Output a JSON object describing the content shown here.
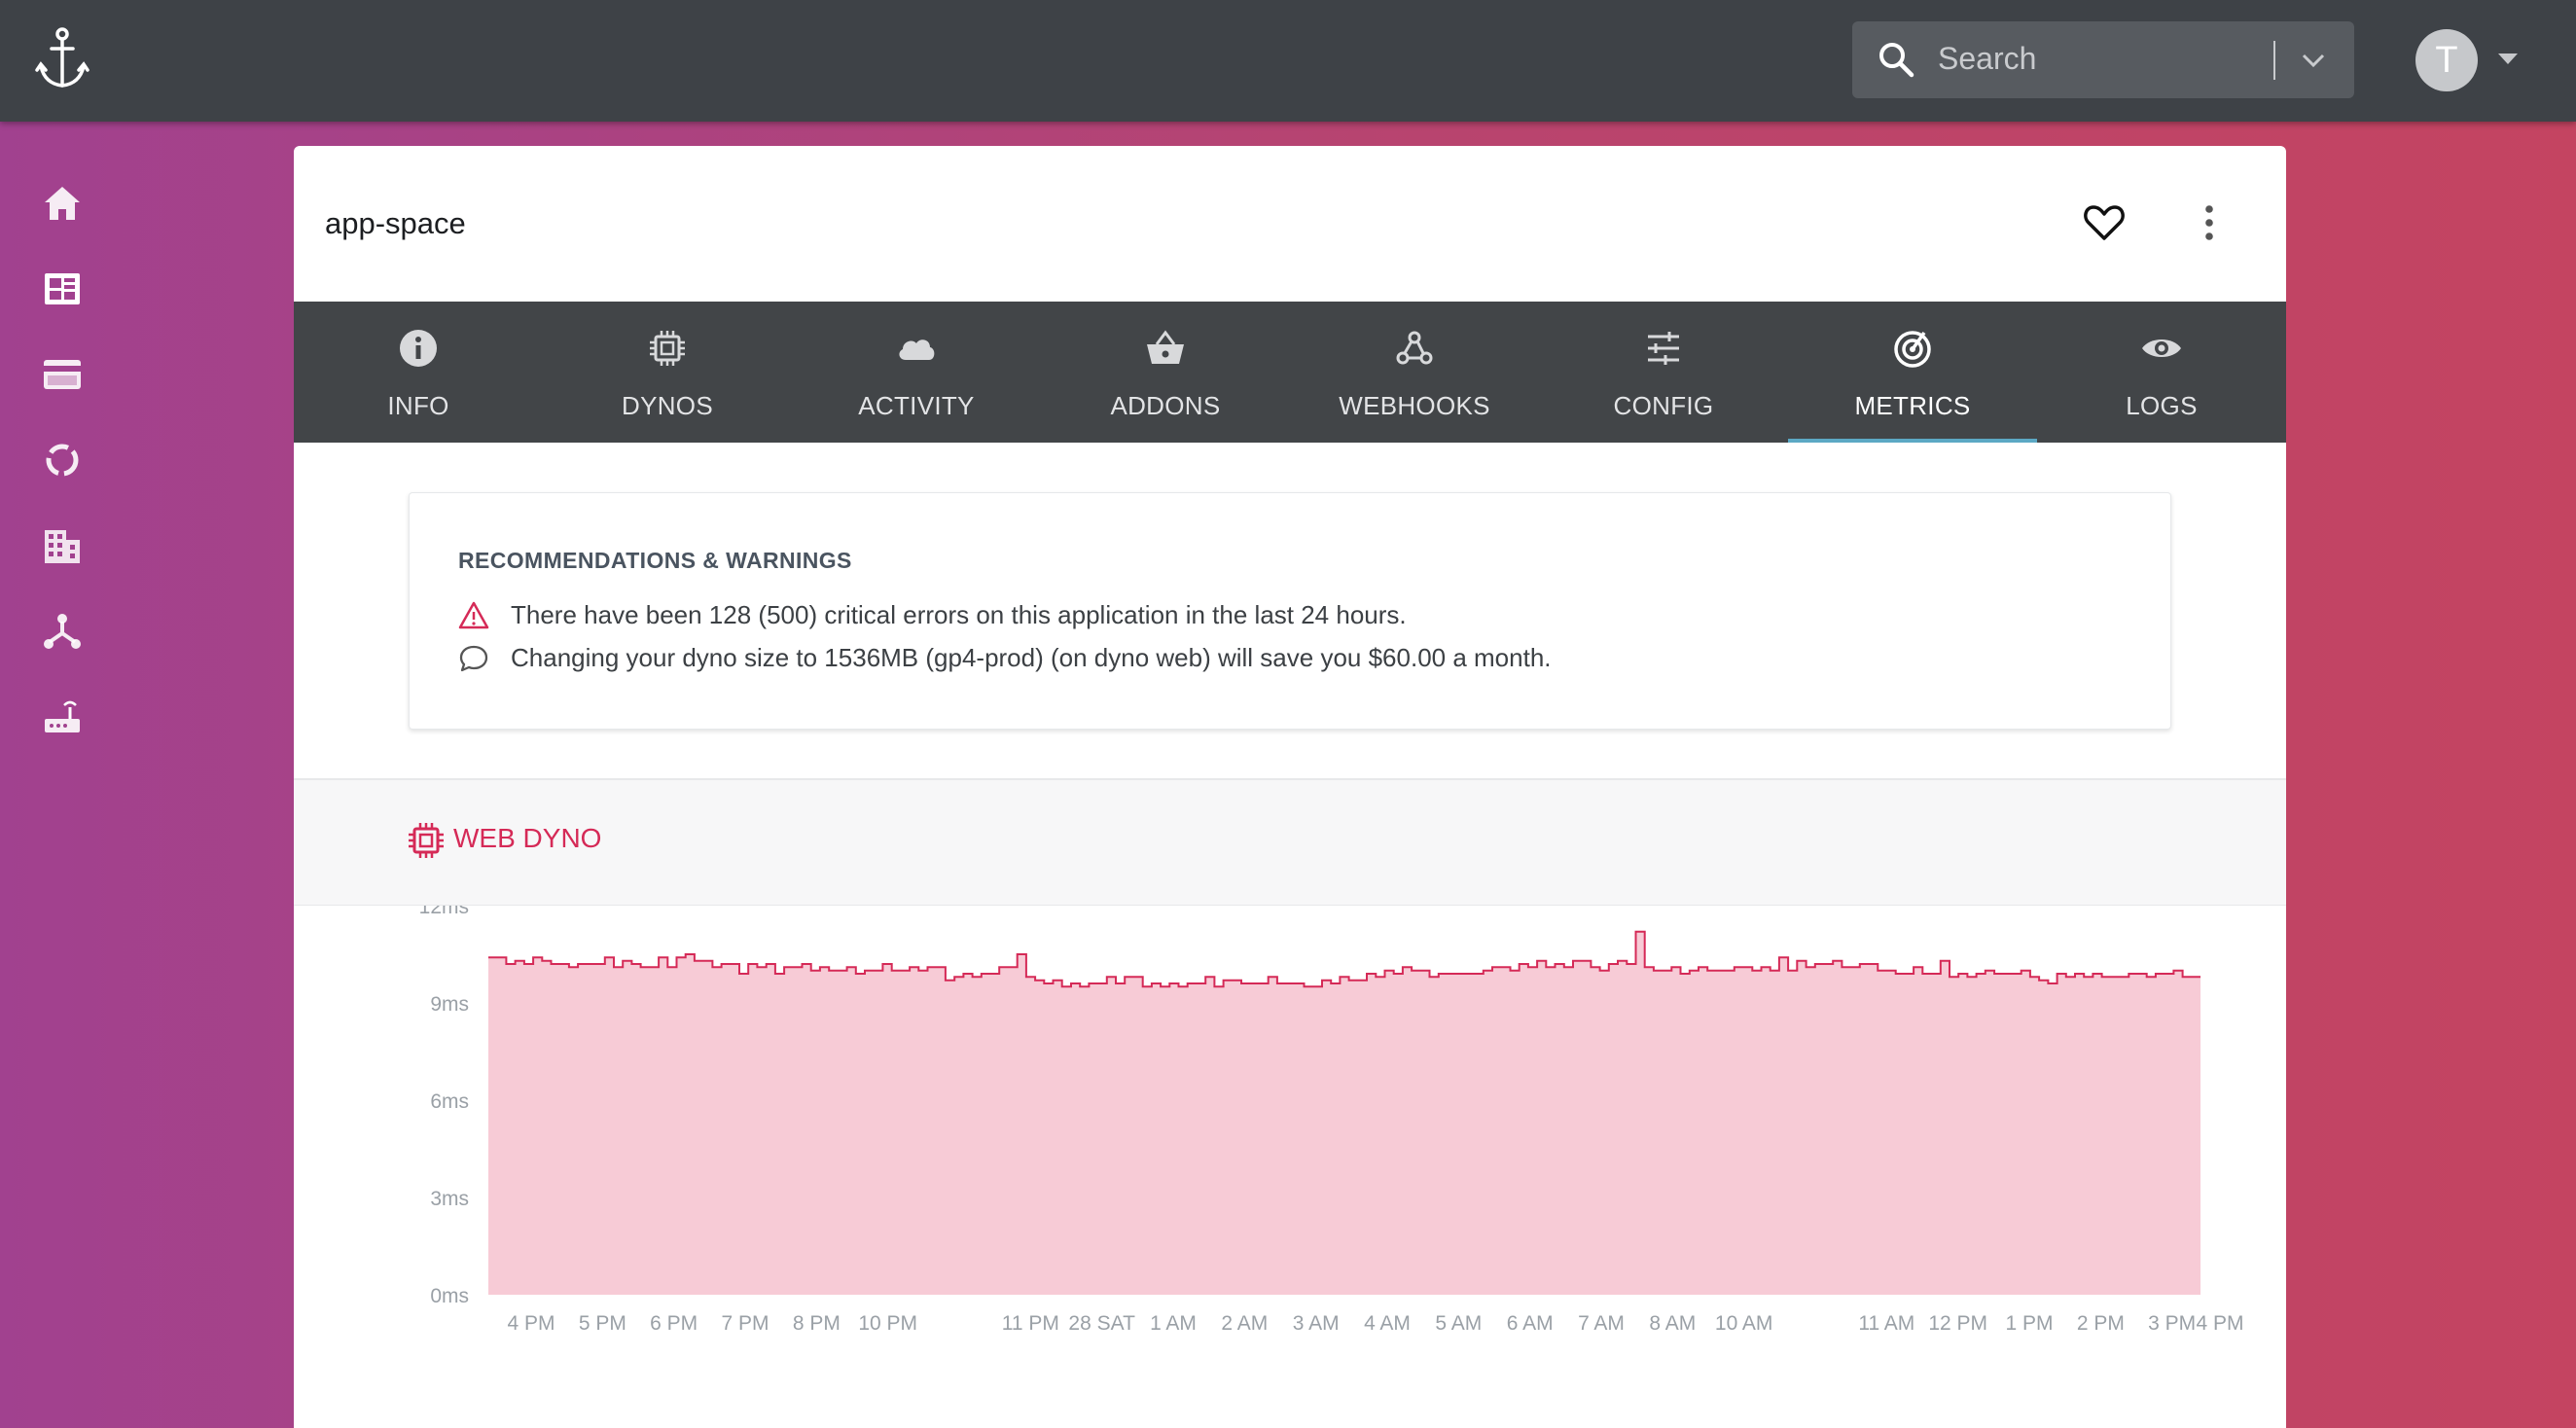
{
  "topbar": {
    "logo_icon": "anchor-icon",
    "search_placeholder": "Search",
    "avatar_initial": "T"
  },
  "sidebar": {
    "items": [
      {
        "icon": "home-icon"
      },
      {
        "icon": "dashboard-icon"
      },
      {
        "icon": "credit-card-icon"
      },
      {
        "icon": "pipeline-icon"
      },
      {
        "icon": "building-icon"
      },
      {
        "icon": "network-icon"
      },
      {
        "icon": "router-icon"
      }
    ]
  },
  "app": {
    "name": "app-space"
  },
  "tabs": [
    {
      "label": "INFO",
      "icon": "info-icon"
    },
    {
      "label": "DYNOS",
      "icon": "chip-icon"
    },
    {
      "label": "ACTIVITY",
      "icon": "cloud-icon"
    },
    {
      "label": "ADDONS",
      "icon": "basket-icon"
    },
    {
      "label": "WEBHOOKS",
      "icon": "webhook-icon"
    },
    {
      "label": "CONFIG",
      "icon": "sliders-icon"
    },
    {
      "label": "METRICS",
      "icon": "target-icon",
      "active": true
    },
    {
      "label": "LOGS",
      "icon": "eye-icon"
    }
  ],
  "recommendations": {
    "title": "RECOMMENDATIONS & WARNINGS",
    "items": [
      {
        "icon": "warning-icon",
        "text": "There have been 128 (500) critical errors on this application in the last 24 hours."
      },
      {
        "icon": "comment-icon",
        "text": "Changing your dyno size to 1536MB (gp4-prod) (on dyno web) will save you $60.00 a month."
      }
    ]
  },
  "dyno_section": {
    "label": "WEB DYNO",
    "icon": "chip-icon"
  },
  "colors": {
    "accent": "#d52a57",
    "area_fill": "#f7cbd6",
    "tab_underline": "#5ca8c4"
  },
  "chart_data": {
    "type": "area",
    "ylim": [
      0,
      12
    ],
    "yticks": [
      "0ms",
      "3ms",
      "6ms",
      "9ms",
      "12ms"
    ],
    "x_tick_labels": [
      "4 PM",
      "5 PM",
      "6 PM",
      "7 PM",
      "8 PM",
      "10 PM",
      "11 PM",
      "28 SAT",
      "1 AM",
      "2 AM",
      "3 AM",
      "4 AM",
      "5 AM",
      "6 AM",
      "7 AM",
      "8 AM",
      "10 AM",
      "11 AM",
      "12 PM",
      "1 PM",
      "2 PM",
      "3 PM",
      "4 PM"
    ],
    "x_positions_hours": [
      0,
      1,
      2,
      3,
      4,
      5,
      6,
      7,
      8,
      9,
      10,
      11,
      12,
      13,
      14,
      15,
      16,
      17,
      18,
      19,
      20,
      21,
      22,
      23,
      24
    ],
    "series": [
      {
        "values": [
          10.4,
          10.4,
          10.2,
          10.3,
          10.2,
          10.4,
          10.3,
          10.2,
          10.2,
          10.1,
          10.2,
          10.2,
          10.2,
          10.4,
          10.1,
          10.3,
          10.2,
          10.1,
          10.1,
          10.4,
          10.1,
          10.4,
          10.5,
          10.3,
          10.3,
          10.1,
          10.2,
          10.2,
          9.9,
          10.2,
          10.1,
          10.2,
          9.9,
          10.1,
          10.1,
          10.2,
          10.0,
          10.1,
          10.0,
          10.0,
          10.1,
          9.9,
          10.0,
          10.0,
          10.2,
          10.0,
          10.0,
          10.1,
          10.0,
          10.1,
          10.1,
          9.7,
          9.8,
          9.9,
          9.8,
          9.9,
          9.9,
          10.1,
          10.1,
          10.5,
          9.8,
          9.7,
          9.6,
          9.7,
          9.5,
          9.6,
          9.5,
          9.6,
          9.6,
          9.8,
          9.6,
          9.8,
          9.8,
          9.5,
          9.6,
          9.5,
          9.6,
          9.5,
          9.6,
          9.6,
          9.8,
          9.5,
          9.7,
          9.7,
          9.6,
          9.6,
          9.6,
          9.8,
          9.6,
          9.6,
          9.6,
          9.5,
          9.5,
          9.7,
          9.6,
          9.8,
          9.7,
          9.7,
          9.9,
          9.8,
          10.0,
          9.9,
          10.1,
          10.0,
          10.0,
          9.8,
          9.9,
          9.9,
          9.9,
          9.9,
          9.9,
          10.0,
          10.1,
          10.1,
          10.0,
          10.2,
          10.1,
          10.3,
          10.1,
          10.2,
          10.1,
          10.3,
          10.3,
          10.1,
          10.0,
          10.2,
          10.3,
          10.2,
          11.2,
          10.1,
          10.0,
          10.0,
          10.1,
          9.9,
          10.0,
          10.1,
          10.0,
          10.0,
          10.0,
          10.1,
          10.1,
          10.0,
          10.1,
          10.0,
          10.4,
          10.0,
          10.3,
          10.1,
          10.2,
          10.2,
          10.3,
          10.1,
          10.1,
          10.2,
          10.2,
          10.0,
          10.0,
          9.9,
          9.9,
          10.1,
          9.9,
          9.9,
          10.3,
          9.8,
          9.9,
          9.8,
          9.9,
          10.0,
          9.9,
          9.9,
          9.9,
          10.0,
          9.8,
          9.7,
          9.6,
          9.9,
          9.8,
          9.9,
          9.8,
          9.9,
          9.8,
          9.8,
          9.8,
          9.9,
          9.9,
          9.8,
          9.9,
          9.9,
          10.0,
          9.8,
          9.8
        ]
      }
    ]
  }
}
